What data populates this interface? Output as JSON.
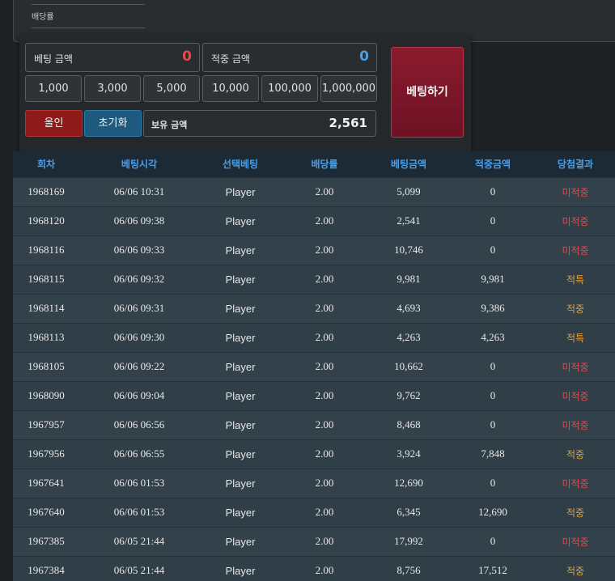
{
  "top_panel": {
    "odds_label": "배당률"
  },
  "bet_panel": {
    "bet_amount_label": "베팅 금액",
    "bet_amount_value": "0",
    "win_amount_label": "적중 금액",
    "win_amount_value": "0",
    "chips": [
      "1,000",
      "3,000",
      "5,000",
      "10,000",
      "100,000",
      "1,000,000"
    ],
    "allin_label": "올인",
    "reset_label": "초기화",
    "balance_label": "보유 금액",
    "balance_value": "2,561",
    "bet_button_label": "베팅하기"
  },
  "history": {
    "headers": [
      "회차",
      "베팅시각",
      "선택베팅",
      "배당률",
      "베팅금액",
      "적중금액",
      "당첨결과"
    ],
    "rows": [
      [
        "1968169",
        "06/06 10:31",
        "Player",
        "2.00",
        "5,099",
        "0",
        "미적중"
      ],
      [
        "1968120",
        "06/06 09:38",
        "Player",
        "2.00",
        "2,541",
        "0",
        "미적중"
      ],
      [
        "1968116",
        "06/06 09:33",
        "Player",
        "2.00",
        "10,746",
        "0",
        "미적중"
      ],
      [
        "1968115",
        "06/06 09:32",
        "Player",
        "2.00",
        "9,981",
        "9,981",
        "적특"
      ],
      [
        "1968114",
        "06/06 09:31",
        "Player",
        "2.00",
        "4,693",
        "9,386",
        "적중"
      ],
      [
        "1968113",
        "06/06 09:30",
        "Player",
        "2.00",
        "4,263",
        "4,263",
        "적특"
      ],
      [
        "1968105",
        "06/06 09:22",
        "Player",
        "2.00",
        "10,662",
        "0",
        "미적중"
      ],
      [
        "1968090",
        "06/06 09:04",
        "Player",
        "2.00",
        "9,762",
        "0",
        "미적중"
      ],
      [
        "1967957",
        "06/06 06:56",
        "Player",
        "2.00",
        "8,468",
        "0",
        "미적중"
      ],
      [
        "1967956",
        "06/06 06:55",
        "Player",
        "2.00",
        "3,924",
        "7,848",
        "적중"
      ],
      [
        "1967641",
        "06/06 01:53",
        "Player",
        "2.00",
        "12,690",
        "0",
        "미적중"
      ],
      [
        "1967640",
        "06/06 01:53",
        "Player",
        "2.00",
        "6,345",
        "12,690",
        "적중"
      ],
      [
        "1967385",
        "06/05 21:44",
        "Player",
        "2.00",
        "17,992",
        "0",
        "미적중"
      ],
      [
        "1967384",
        "06/05 21:44",
        "Player",
        "2.00",
        "8,756",
        "17,512",
        "적중"
      ]
    ]
  },
  "colors": {
    "miss": "#e84848",
    "hit": "#f0a030",
    "header_text": "#4a9ee8"
  }
}
